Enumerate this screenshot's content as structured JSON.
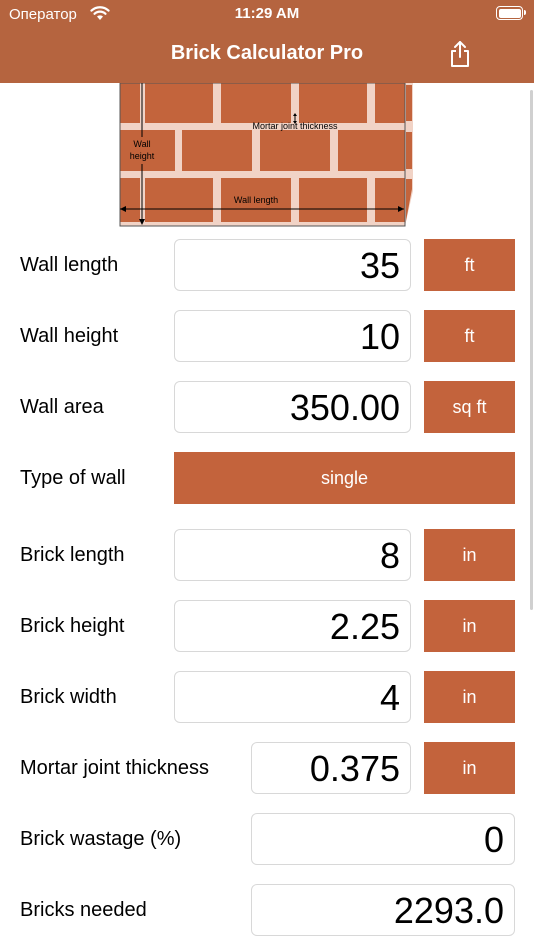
{
  "status_bar": {
    "carrier": "Оператор",
    "time": "11:29 AM"
  },
  "nav": {
    "title": "Brick Calculator Pro",
    "share_icon": "share-icon"
  },
  "diagram": {
    "wall_height_line1": "Wall",
    "wall_height_line2": "height",
    "mortar_joint_label": "Mortar joint thickness",
    "wall_length_label": "Wall length"
  },
  "colors": {
    "header": "#B5643F",
    "button": "#C3633C"
  },
  "form": {
    "wall_length": {
      "label": "Wall length",
      "value": "35",
      "unit": "ft"
    },
    "wall_height": {
      "label": "Wall height",
      "value": "10",
      "unit": "ft"
    },
    "wall_area": {
      "label": "Wall area",
      "value": "350.00",
      "unit": "sq ft"
    },
    "wall_type": {
      "label": "Type of wall",
      "value": "single"
    },
    "brick_length": {
      "label": "Brick length",
      "value": "8",
      "unit": "in"
    },
    "brick_height": {
      "label": "Brick height",
      "value": "2.25",
      "unit": "in"
    },
    "brick_width": {
      "label": "Brick width",
      "value": "4",
      "unit": "in"
    },
    "mortar_joint": {
      "label": "Mortar joint thickness",
      "value": "0.375",
      "unit": "in"
    },
    "brick_wastage": {
      "label": "Brick wastage (%)",
      "value": "0"
    },
    "bricks_needed": {
      "label": "Bricks needed",
      "value": "2293.0"
    }
  }
}
